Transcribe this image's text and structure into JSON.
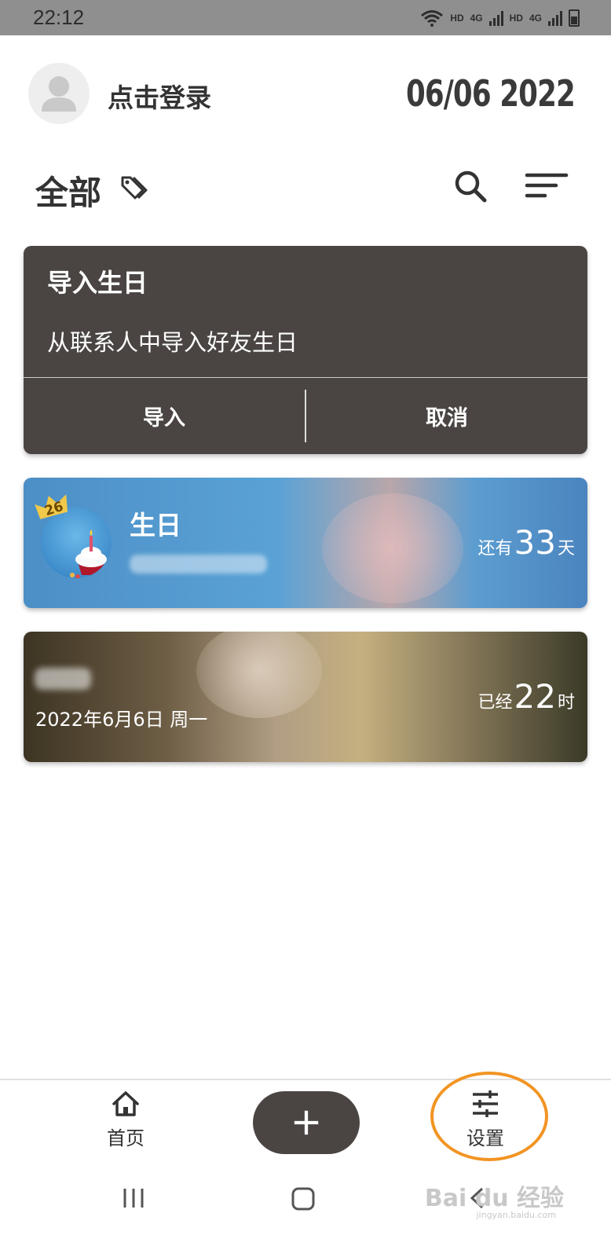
{
  "status_bar": {
    "time": "22:12",
    "indicators": [
      "wifi-icon",
      "HD",
      "4G",
      "HD",
      "4G",
      "battery-icon"
    ]
  },
  "header": {
    "login_text": "点击登录",
    "date": "06/06 2022"
  },
  "toolbar": {
    "category_title": "全部",
    "icons": [
      "tag-icon",
      "search-icon",
      "sort-icon"
    ]
  },
  "import_card": {
    "title": "导入生日",
    "description": "从联系人中导入好友生日",
    "import_label": "导入",
    "cancel_label": "取消"
  },
  "events": [
    {
      "title": "生日",
      "badge_age": "26",
      "count_prefix": "还有",
      "count_value": "33",
      "count_unit": "天"
    },
    {
      "date_text": "2022年6月6日 周一",
      "count_prefix": "已经",
      "count_value": "22",
      "count_unit": "时"
    }
  ],
  "bottom_nav": {
    "home_label": "首页",
    "settings_label": "设置"
  },
  "colors": {
    "card_dark": "#4a4543",
    "highlight": "#f29423"
  },
  "watermark": {
    "text": "Bai du 经验",
    "url": "jingyan.baidu.com"
  }
}
